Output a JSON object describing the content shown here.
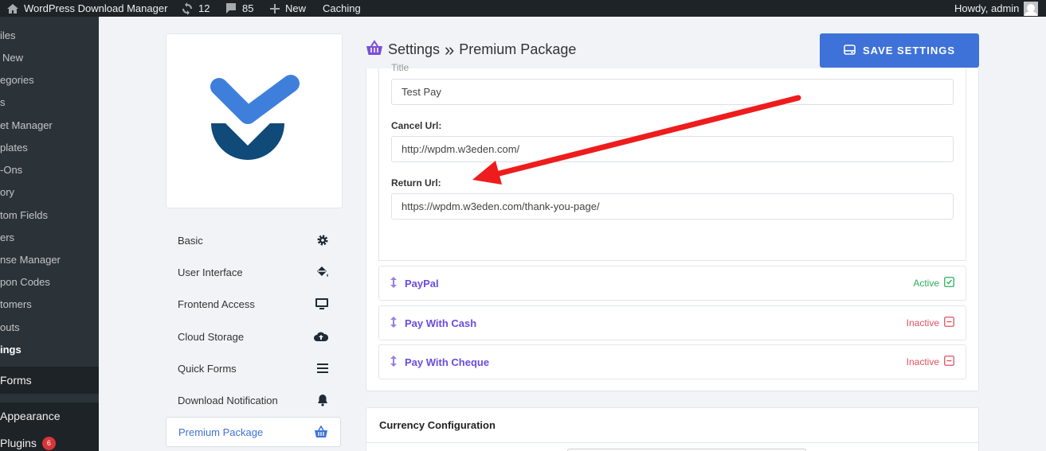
{
  "adminbar": {
    "site_name": "WordPress Download Manager",
    "updates_count": "12",
    "comments_count": "85",
    "new_label": "New",
    "caching_label": "Caching",
    "howdy": "Howdy, admin"
  },
  "wp_menu": {
    "sub_items": [
      "iles",
      "New",
      "egories",
      "s",
      "et Manager",
      "plates",
      "-Ons",
      "ory",
      "tom Fields",
      "ers",
      "nse Manager",
      "pon Codes",
      "tomers",
      "outs",
      "ings"
    ],
    "forms": "Forms",
    "appearance": "Appearance",
    "plugins": "Plugins",
    "plugins_badge": "6"
  },
  "settings_nav": [
    {
      "label": "Basic",
      "icon": "gear-icon"
    },
    {
      "label": "User Interface",
      "icon": "paint-bucket-icon"
    },
    {
      "label": "Frontend Access",
      "icon": "desktop-icon"
    },
    {
      "label": "Cloud Storage",
      "icon": "cloud-upload-icon"
    },
    {
      "label": "Quick Forms",
      "icon": "list-icon"
    },
    {
      "label": "Download Notification",
      "icon": "bell-icon"
    },
    {
      "label": "Premium Package",
      "icon": "basket-icon"
    }
  ],
  "header": {
    "title": "Settings",
    "separator": "»",
    "subtitle": "Premium Package",
    "save_label": "SAVE SETTINGS"
  },
  "form": {
    "title_label": "Title",
    "title_value": "Test Pay",
    "cancel_label": "Cancel Url:",
    "cancel_value": "http://wpdm.w3eden.com/",
    "return_label": "Return Url:",
    "return_value": "https://wpdm.w3eden.com/thank-you-page/"
  },
  "gateways": [
    {
      "name": "PayPal",
      "status": "Active"
    },
    {
      "name": "Pay With Cash",
      "status": "Inactive"
    },
    {
      "name": "Pay With Cheque",
      "status": "Inactive"
    }
  ],
  "currency": {
    "heading": "Currency Configuration"
  },
  "colors": {
    "accent": "#3f72d8",
    "gateway_name": "#6a4ce0",
    "active": "#2eae5b",
    "inactive": "#e05260",
    "arrow": "#ee1c1c"
  }
}
